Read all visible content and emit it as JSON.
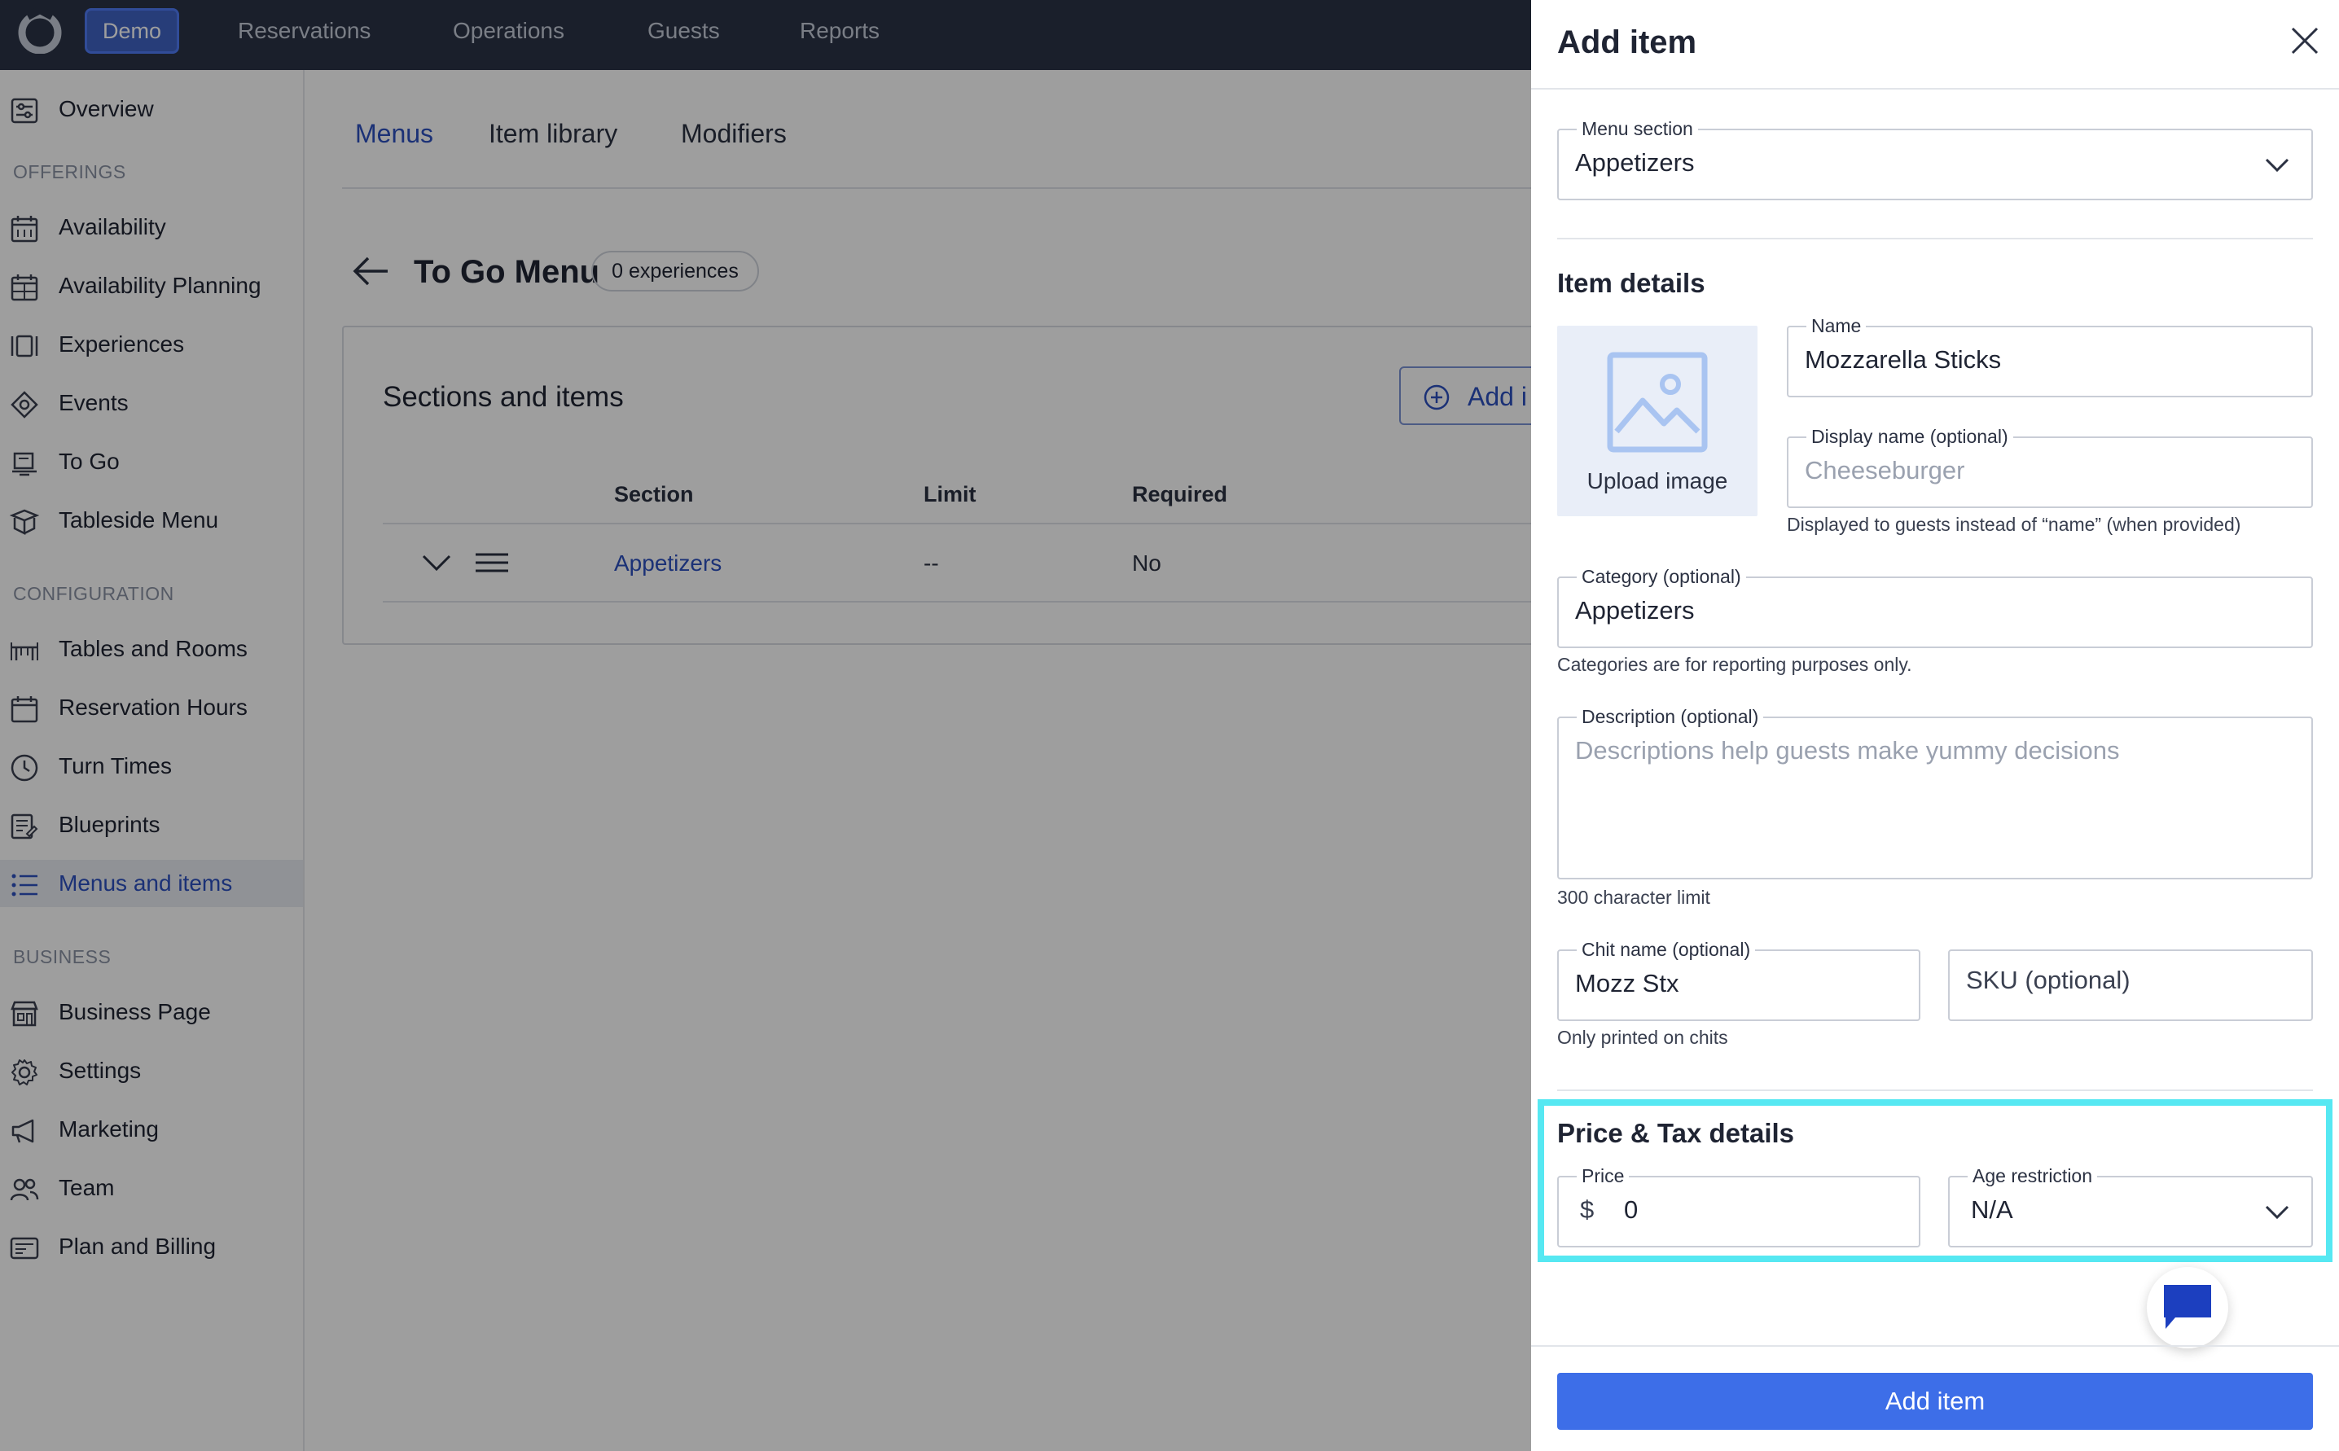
{
  "topbar": {
    "badge": "Demo",
    "nav": [
      "Reservations",
      "Operations",
      "Guests",
      "Reports"
    ]
  },
  "sidebar": {
    "overview": "Overview",
    "offerings_heading": "OFFERINGS",
    "offerings": [
      "Availability",
      "Availability Planning",
      "Experiences",
      "Events",
      "To Go",
      "Tableside Menu"
    ],
    "configuration_heading": "CONFIGURATION",
    "configuration": [
      "Tables and Rooms",
      "Reservation Hours",
      "Turn Times",
      "Blueprints",
      "Menus and items"
    ],
    "business_heading": "BUSINESS",
    "business": [
      "Business Page",
      "Settings",
      "Marketing",
      "Team",
      "Plan and Billing"
    ]
  },
  "main": {
    "tabs": [
      "Menus",
      "Item library",
      "Modifiers"
    ],
    "menu_title": "To Go Menu",
    "experiences_badge": "0 experiences",
    "card_title": "Sections and items",
    "add_button": "Add i",
    "columns": [
      "Section",
      "Limit",
      "Required"
    ],
    "rows": [
      {
        "section": "Appetizers",
        "limit": "--",
        "required": "No"
      }
    ]
  },
  "drawer": {
    "title": "Add item",
    "menu_section": {
      "label": "Menu section",
      "value": "Appetizers"
    },
    "item_details_title": "Item details",
    "upload_label": "Upload image",
    "name": {
      "label": "Name",
      "value": "Mozzarella Sticks"
    },
    "display_name": {
      "label": "Display name (optional)",
      "placeholder": "Cheeseburger",
      "helper": "Displayed to guests instead of “name” (when provided)"
    },
    "category": {
      "label": "Category (optional)",
      "value": "Appetizers",
      "helper": "Categories are for reporting purposes only."
    },
    "description": {
      "label": "Description (optional)",
      "placeholder": "Descriptions help guests make yummy decisions",
      "helper": "300 character limit"
    },
    "chit_name": {
      "label": "Chit name (optional)",
      "value": "Mozz Stx",
      "helper": "Only printed on chits"
    },
    "sku": {
      "placeholder": "SKU (optional)"
    },
    "price_tax_title": "Price & Tax details",
    "price": {
      "label": "Price",
      "currency": "$",
      "value": "0"
    },
    "age_restriction": {
      "label": "Age restriction",
      "value": "N/A"
    },
    "submit": "Add item"
  },
  "colors": {
    "topbar": "#2a3346",
    "accent": "#2c4fbf",
    "primary_button": "#3d6ee8",
    "highlight": "#56e8f2"
  }
}
